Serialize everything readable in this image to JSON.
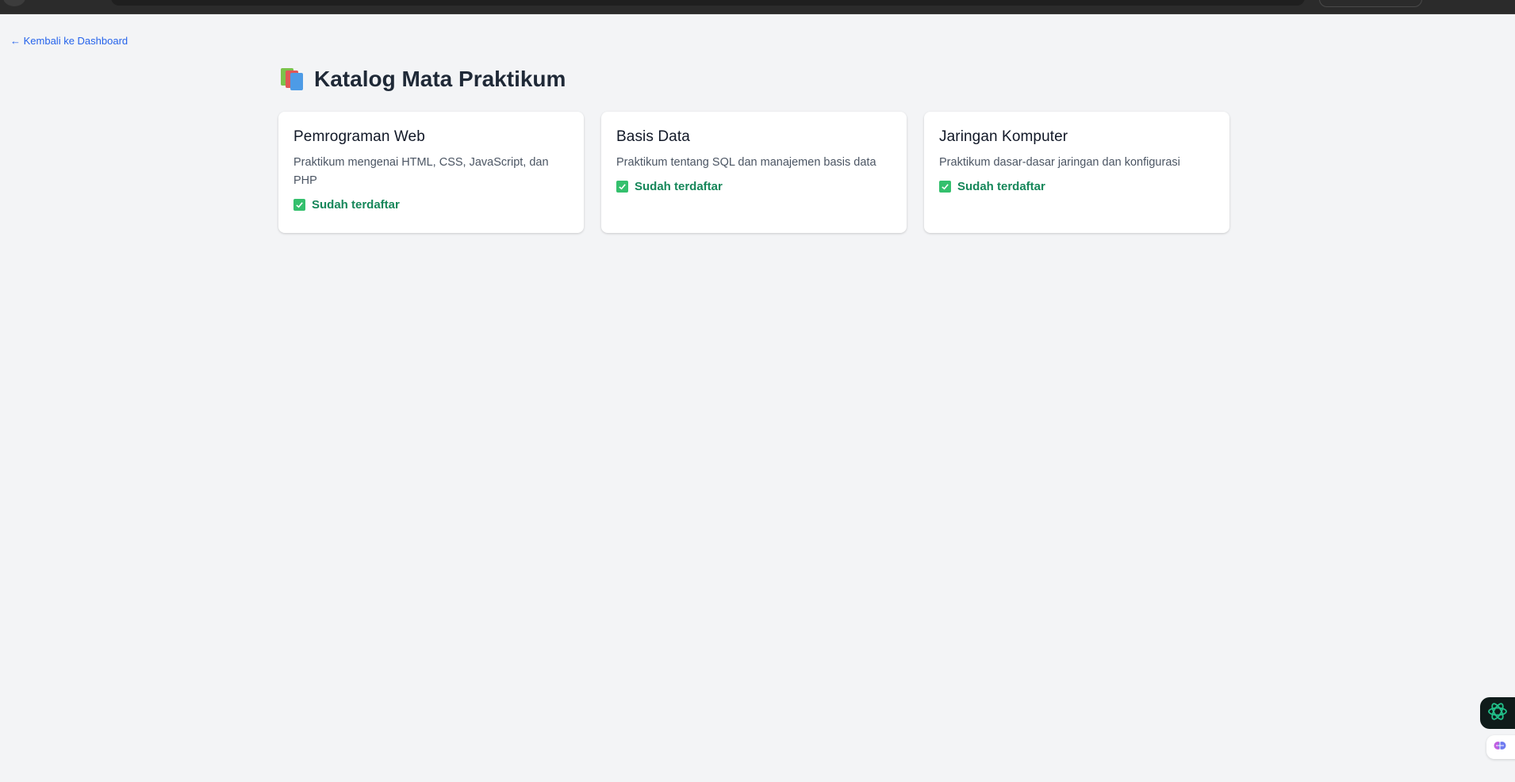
{
  "nav": {
    "back_label": "← Kembali ke Dashboard"
  },
  "page": {
    "title": "Katalog Mata Praktikum",
    "title_icon": "books-icon"
  },
  "courses": [
    {
      "title": "Pemrograman Web",
      "description": "Praktikum mengenai HTML, CSS, JavaScript, dan PHP",
      "status": "Sudah terdaftar"
    },
    {
      "title": "Basis Data",
      "description": "Praktikum tentang SQL dan manajemen basis data",
      "status": "Sudah terdaftar"
    },
    {
      "title": "Jaringan Komputer",
      "description": "Praktikum dasar-dasar jaringan dan konfigurasi",
      "status": "Sudah terdaftar"
    }
  ],
  "colors": {
    "background": "#f3f4f6",
    "link": "#2563eb",
    "status_green": "#16875a",
    "check_green": "#34c06d"
  },
  "widgets": {
    "assistant_icon": "openai-icon",
    "extension_icon": "brain-icon"
  }
}
